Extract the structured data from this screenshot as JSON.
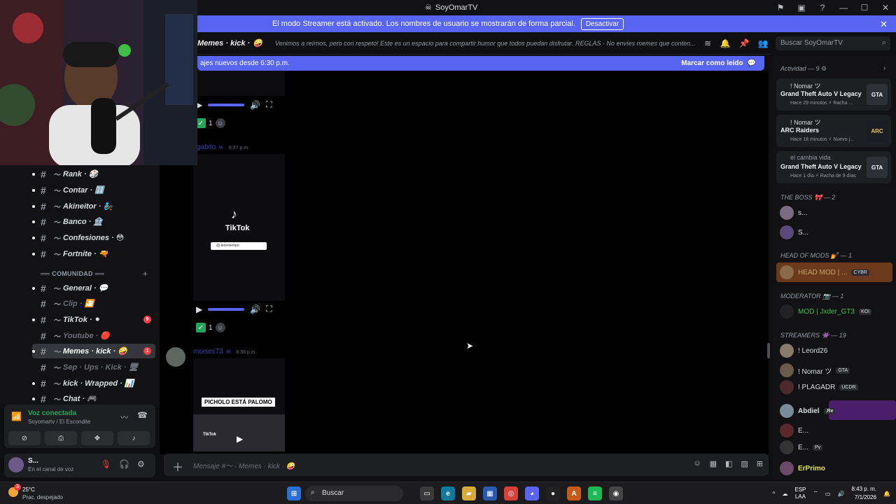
{
  "window": {
    "title": "SoyOmarTV"
  },
  "streamer_banner": {
    "text": "El modo Streamer está activado. Los nombres de usuario se mostrarán de forma parcial.",
    "button": "Desactivar"
  },
  "header": {
    "channel": "Memes · kick ·",
    "topic": "Venimos a reírnos, pero con respeto! Este es un espacio para compartir humor que todos puedan disfrutar. REGLAS · No envíes memes que conten...",
    "search_placeholder": "Buscar SoyOmarTV"
  },
  "new_messages": {
    "text": "ajes nuevos desde 6:30 p.m.",
    "mark_read": "Marcar como leído"
  },
  "sidebar": {
    "channels_top": [
      {
        "label": "Rank ·",
        "emoji": "🎲"
      },
      {
        "label": "Contar ·",
        "emoji": "🔢"
      },
      {
        "label": "Akineitor ·",
        "emoji": "🧞"
      },
      {
        "label": "Banco ·",
        "emoji": "🏦"
      },
      {
        "label": "Confesiones ·",
        "emoji": "😳"
      },
      {
        "label": "Fortnite ·",
        "emoji": "🔫"
      }
    ],
    "category": "══ COMUNIDAD ══",
    "channels_bottom": [
      {
        "label": "General ·",
        "emoji": "💬"
      },
      {
        "label": "Clip ·",
        "emoji": "🎦"
      },
      {
        "label": "TikTok ·",
        "emoji": "⚫",
        "badge": "9"
      },
      {
        "label": "Youtube ·",
        "emoji": "🔴"
      },
      {
        "label": "Memes · kick ·",
        "emoji": "🤪",
        "badge": "1"
      },
      {
        "label": "Sep · Ups · Kick ·",
        "emoji": "🖥"
      },
      {
        "label": "kick · Wrapped ·",
        "emoji": "📊"
      },
      {
        "label": "Chat ·",
        "emoji": "🎮"
      }
    ]
  },
  "voice": {
    "status": "Voz conectada",
    "location": "Soyomartv / El Escondite"
  },
  "user": {
    "name": "S...",
    "status": "En el canal de voz"
  },
  "messages": [
    {
      "author": "",
      "time": "",
      "reaction_count": "1"
    },
    {
      "author": "ygabito",
      "time": "6:37 p.m.",
      "reaction_count": "1",
      "media_label": "TikTok",
      "media_search": "@ tecentempo"
    },
    {
      "author": "moises73",
      "time": "6:38 p.m.",
      "media_caption": "PICHOLO ESTÁ PALOMO",
      "media_label": "TikTok"
    }
  ],
  "composer": {
    "placeholder": "Mensaje #〜 · Memes · kick · 🤪"
  },
  "members": {
    "activity_header": "Actividad — 9",
    "activities": [
      {
        "name": "! Nomar ツ",
        "game": "Grand Theft Auto V Legacy",
        "meta": "Hace 29 minutos  ⚡ Racha ...",
        "thumb": "GTA"
      },
      {
        "name": "! Nomar ツ",
        "game": "ARC Raiders",
        "meta": "Hace 18 minutos  ⚡ Nuevo j...",
        "thumb": "ARC"
      },
      {
        "name": "el cambia vida",
        "game": "Grand Theft Auto V Legacy",
        "meta": "Hace 1 día  ⚡ Racha de 9 días",
        "thumb": "GTA"
      }
    ],
    "sections": [
      {
        "title": "THE BOSS 🎀 — 2",
        "members": [
          {
            "name": "s..."
          },
          {
            "name": "S..."
          }
        ]
      },
      {
        "title": "HEAD OF MODS 💅 — 1",
        "members": [
          {
            "name": "HEAD MOD | ...",
            "tag": "CYBR"
          }
        ]
      },
      {
        "title": "MODERATOR 📷 — 1",
        "members": [
          {
            "name": "MOD | Jxder_GT3",
            "tag": "KOI"
          }
        ]
      },
      {
        "title": "STREAMERS 👾 — 19",
        "members": [
          {
            "name": "! Leord26"
          },
          {
            "name": "! Nomar ツ",
            "tag": "GTA"
          },
          {
            "name": "! PLAGADR",
            "tag": "UCDR"
          },
          {
            "name": "Abdiel",
            "tag": ".Re"
          },
          {
            "name": "E..."
          },
          {
            "name": "E...",
            "tag": "Pv"
          },
          {
            "name": "ErPrimo"
          }
        ]
      }
    ]
  },
  "taskbar": {
    "temp": "25°C",
    "weather": "Prac. despejado",
    "search": "Buscar",
    "lang": "ESP",
    "lang2": "LAA",
    "time": "8:43 p. m.",
    "date": "7/1/2026",
    "notif": "3"
  },
  "colors": {
    "accent": "#5865f2",
    "online": "#23a55a",
    "danger": "#f23f43"
  }
}
